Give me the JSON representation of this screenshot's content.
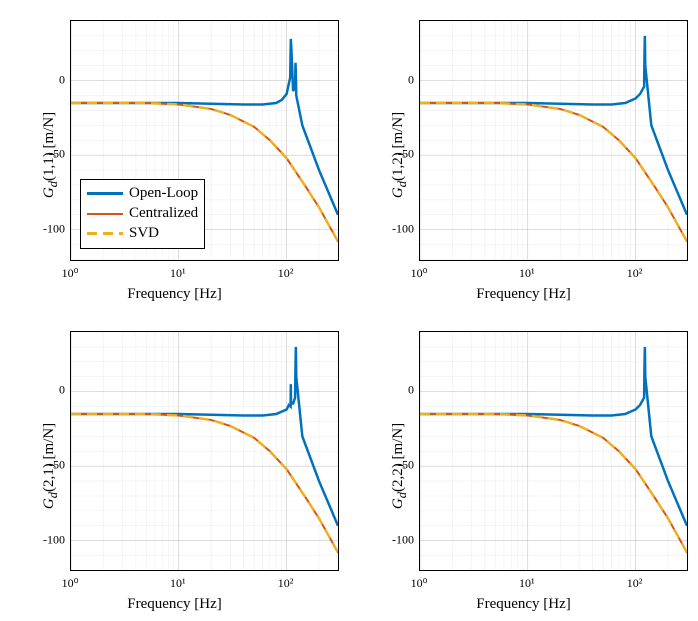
{
  "legend": {
    "openloop": "Open-Loop",
    "centralized": "Centralized",
    "svd": "SVD"
  },
  "common": {
    "xlabel": "Frequency [Hz]",
    "xticks": [
      "10⁰",
      "10¹",
      "10²"
    ],
    "xtick_vals": [
      1,
      10,
      100
    ],
    "yticks": [
      "-100",
      "-50",
      "0"
    ],
    "ytick_vals": [
      -100,
      -50,
      0
    ],
    "xlim": [
      1,
      300
    ],
    "ylim": [
      -120,
      40
    ]
  },
  "panels": [
    {
      "ylabel": "Gd(1,1) [m/N]"
    },
    {
      "ylabel": "Gd(1,2) [m/N]"
    },
    {
      "ylabel": "Gd(2,1) [m/N]"
    },
    {
      "ylabel": "Gd(2,2) [m/N]"
    }
  ],
  "chart_data": [
    {
      "type": "line",
      "xscale": "log",
      "title": "Gd(1,1)",
      "xlabel": "Frequency [Hz]",
      "ylabel": "Gd(1,1) [m/N]",
      "ylim": [
        -120,
        40
      ],
      "xlim": [
        1,
        300
      ],
      "series": [
        {
          "name": "Open-Loop",
          "x": [
            1,
            2,
            5,
            10,
            20,
            40,
            60,
            80,
            90,
            100,
            108,
            109.5,
            111,
            115,
            120,
            121,
            122,
            123,
            140,
            200,
            300
          ],
          "y": [
            -15,
            -15,
            -15,
            -15,
            -15.5,
            -16,
            -16,
            -15,
            -13,
            -9,
            2,
            28,
            20,
            -7,
            -4,
            12,
            5,
            -10,
            -30,
            -60,
            -90
          ]
        },
        {
          "name": "Centralized",
          "x": [
            1,
            2,
            5,
            10,
            20,
            30,
            50,
            70,
            100,
            150,
            200,
            300
          ],
          "y": [
            -15,
            -15,
            -15,
            -16,
            -19,
            -23,
            -31,
            -40,
            -52,
            -71,
            -85,
            -108
          ]
        },
        {
          "name": "SVD",
          "x": [
            1,
            2,
            5,
            10,
            20,
            30,
            50,
            70,
            100,
            150,
            200,
            300
          ],
          "y": [
            -15,
            -15,
            -15,
            -16,
            -19,
            -23,
            -31,
            -40,
            -52,
            -71,
            -85,
            -108
          ]
        }
      ]
    },
    {
      "type": "line",
      "xscale": "log",
      "title": "Gd(1,2)",
      "xlabel": "Frequency [Hz]",
      "ylabel": "Gd(1,2) [m/N]",
      "ylim": [
        -120,
        40
      ],
      "xlim": [
        1,
        300
      ],
      "series": [
        {
          "name": "Open-Loop",
          "x": [
            1,
            2,
            5,
            10,
            20,
            40,
            60,
            80,
            100,
            110,
            120,
            121,
            122,
            123,
            140,
            200,
            300
          ],
          "y": [
            -15,
            -15,
            -15,
            -15,
            -15.5,
            -16,
            -16,
            -15,
            -12,
            -9,
            -4,
            18,
            30,
            10,
            -30,
            -60,
            -90
          ]
        },
        {
          "name": "Centralized",
          "x": [
            1,
            2,
            5,
            10,
            20,
            30,
            50,
            70,
            100,
            150,
            200,
            300
          ],
          "y": [
            -15,
            -15,
            -15,
            -16,
            -19,
            -23,
            -31,
            -40,
            -52,
            -71,
            -85,
            -108
          ]
        },
        {
          "name": "SVD",
          "x": [
            1,
            2,
            5,
            10,
            20,
            30,
            50,
            70,
            100,
            150,
            200,
            300
          ],
          "y": [
            -15,
            -15,
            -15,
            -16,
            -19,
            -23,
            -31,
            -40,
            -52,
            -71,
            -85,
            -108
          ]
        }
      ]
    },
    {
      "type": "line",
      "xscale": "log",
      "title": "Gd(2,1)",
      "xlabel": "Frequency [Hz]",
      "ylabel": "Gd(2,1) [m/N]",
      "ylim": [
        -120,
        40
      ],
      "xlim": [
        1,
        300
      ],
      "series": [
        {
          "name": "Open-Loop",
          "x": [
            1,
            2,
            5,
            10,
            20,
            40,
            60,
            80,
            100,
            105,
            109,
            109.5,
            110,
            115,
            120,
            121,
            122,
            123,
            140,
            200,
            300
          ],
          "y": [
            -15,
            -15,
            -15,
            -15,
            -15.5,
            -16,
            -16,
            -15,
            -12,
            -9,
            -10,
            5,
            -8,
            -8,
            -4,
            18,
            30,
            10,
            -30,
            -60,
            -90
          ]
        },
        {
          "name": "Centralized",
          "x": [
            1,
            2,
            5,
            10,
            20,
            30,
            50,
            70,
            100,
            150,
            200,
            300
          ],
          "y": [
            -15,
            -15,
            -15,
            -16,
            -19,
            -23,
            -31,
            -40,
            -52,
            -71,
            -85,
            -108
          ]
        },
        {
          "name": "SVD",
          "x": [
            1,
            2,
            5,
            10,
            20,
            30,
            50,
            70,
            100,
            150,
            200,
            300
          ],
          "y": [
            -15,
            -15,
            -15,
            -16,
            -19,
            -23,
            -31,
            -40,
            -52,
            -71,
            -85,
            -108
          ]
        }
      ]
    },
    {
      "type": "line",
      "xscale": "log",
      "title": "Gd(2,2)",
      "xlabel": "Frequency [Hz]",
      "ylabel": "Gd(2,2) [m/N]",
      "ylim": [
        -120,
        40
      ],
      "xlim": [
        1,
        300
      ],
      "series": [
        {
          "name": "Open-Loop",
          "x": [
            1,
            2,
            5,
            10,
            20,
            40,
            60,
            80,
            100,
            110,
            120,
            121,
            122,
            123,
            140,
            200,
            300
          ],
          "y": [
            -15,
            -15,
            -15,
            -15,
            -15.5,
            -16,
            -16,
            -15,
            -12,
            -9,
            -4,
            18,
            30,
            10,
            -30,
            -60,
            -90
          ]
        },
        {
          "name": "Centralized",
          "x": [
            1,
            2,
            5,
            10,
            20,
            30,
            50,
            70,
            100,
            150,
            200,
            300
          ],
          "y": [
            -15,
            -15,
            -15,
            -16,
            -19,
            -23,
            -31,
            -40,
            -52,
            -71,
            -85,
            -108
          ]
        },
        {
          "name": "SVD",
          "x": [
            1,
            2,
            5,
            10,
            20,
            30,
            50,
            70,
            100,
            150,
            200,
            300
          ],
          "y": [
            -15,
            -15,
            -15,
            -16,
            -19,
            -23,
            -31,
            -40,
            -52,
            -71,
            -85,
            -108
          ]
        }
      ]
    }
  ]
}
